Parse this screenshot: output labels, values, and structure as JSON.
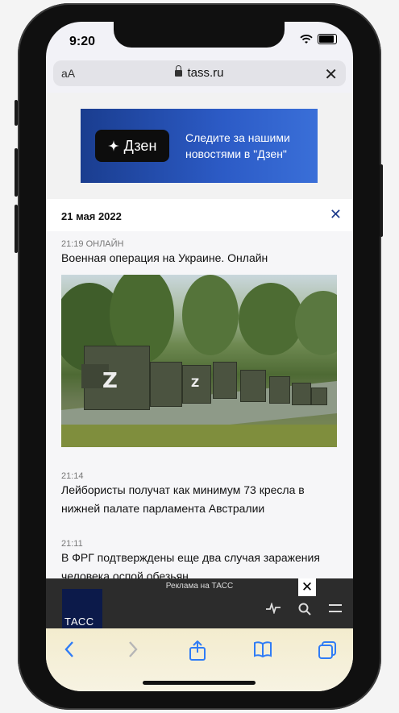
{
  "status_bar": {
    "time": "9:20"
  },
  "browser": {
    "text_size_label": "aA",
    "url": "tass.ru",
    "close_label": "✕"
  },
  "banner": {
    "brand": "Дзен",
    "text": "Следите за нашими новостями в \"Дзен\""
  },
  "feed": {
    "date": "21 мая 2022",
    "close_label": "✕",
    "items": [
      {
        "time": "21:19 ОНЛАЙН",
        "headline": "Военная операция на Украине. Онлайн"
      },
      {
        "time": "21:14",
        "headline": "Лейбористы получат как минимум 73 кресла в нижней палате парламента Австралии"
      },
      {
        "time": "21:11",
        "headline": "В ФРГ подтверждены еще два случая заражения человека оспой обезьян"
      }
    ]
  },
  "ad": {
    "label": "Реклама на ТАСС",
    "close_label": "✕",
    "logo_text": "ТАСС"
  },
  "colors": {
    "banner_blue": "#2c5bc6",
    "link_blue": "#2f7cf6",
    "tass_navy": "#0c1a4a"
  }
}
